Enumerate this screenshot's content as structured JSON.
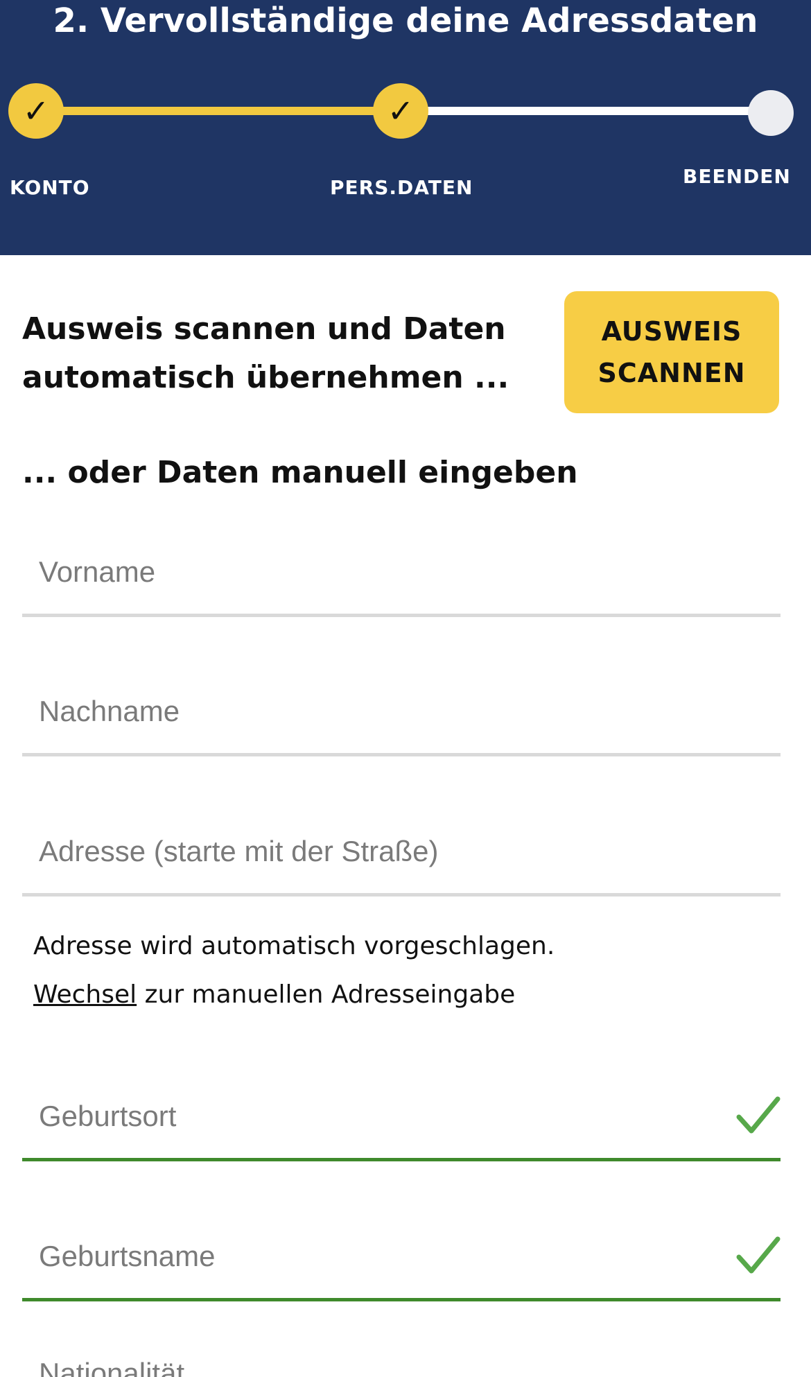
{
  "header": {
    "title": "2. Vervollständige deine Adressdaten",
    "steps": [
      {
        "label": "KONTO",
        "status": "done",
        "icon": "check-icon"
      },
      {
        "label": "PERS.DATEN",
        "status": "done",
        "icon": "check-icon"
      },
      {
        "label": "BEENDEN",
        "status": "pending"
      }
    ],
    "check_glyph": "✓",
    "colors": {
      "background": "#1f3564",
      "accent": "#f2c940"
    }
  },
  "scan": {
    "intro": "Ausweis scannen und Daten automatisch übernehmen ...",
    "button_label": "AUSWEIS SCANNEN"
  },
  "manual": {
    "heading": "... oder Daten manuell eingeben"
  },
  "fields": {
    "vorname": {
      "placeholder": "Vorname",
      "value": ""
    },
    "nachname": {
      "placeholder": "Nachname",
      "value": ""
    },
    "adresse": {
      "placeholder": "Adresse (starte mit der Straße)",
      "value": ""
    },
    "geburtsort": {
      "placeholder": "Geburtsort",
      "value": "",
      "valid": true
    },
    "geburtsname": {
      "placeholder": "Geburtsname",
      "value": "",
      "valid": true
    },
    "nationalitaet": {
      "placeholder": "Nationalität",
      "value": ""
    }
  },
  "address_hint": {
    "line1": "Adresse wird automatisch vorgeschlagen.",
    "link": "Wechsel",
    "line2_rest": " zur manuellen Adresseingabe"
  },
  "colors": {
    "valid": "#3f8a2c",
    "button": "#f7cd45",
    "divider": "#d9d9d9"
  }
}
